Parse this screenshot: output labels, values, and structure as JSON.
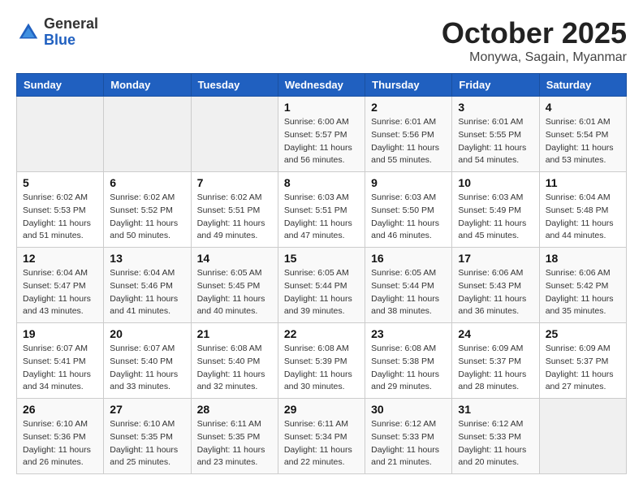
{
  "header": {
    "logo_line1": "General",
    "logo_line2": "Blue",
    "month": "October 2025",
    "location": "Monywa, Sagain, Myanmar"
  },
  "weekdays": [
    "Sunday",
    "Monday",
    "Tuesday",
    "Wednesday",
    "Thursday",
    "Friday",
    "Saturday"
  ],
  "weeks": [
    [
      {
        "day": "",
        "sunrise": "",
        "sunset": "",
        "daylight": ""
      },
      {
        "day": "",
        "sunrise": "",
        "sunset": "",
        "daylight": ""
      },
      {
        "day": "",
        "sunrise": "",
        "sunset": "",
        "daylight": ""
      },
      {
        "day": "1",
        "sunrise": "Sunrise: 6:00 AM",
        "sunset": "Sunset: 5:57 PM",
        "daylight": "Daylight: 11 hours and 56 minutes."
      },
      {
        "day": "2",
        "sunrise": "Sunrise: 6:01 AM",
        "sunset": "Sunset: 5:56 PM",
        "daylight": "Daylight: 11 hours and 55 minutes."
      },
      {
        "day": "3",
        "sunrise": "Sunrise: 6:01 AM",
        "sunset": "Sunset: 5:55 PM",
        "daylight": "Daylight: 11 hours and 54 minutes."
      },
      {
        "day": "4",
        "sunrise": "Sunrise: 6:01 AM",
        "sunset": "Sunset: 5:54 PM",
        "daylight": "Daylight: 11 hours and 53 minutes."
      }
    ],
    [
      {
        "day": "5",
        "sunrise": "Sunrise: 6:02 AM",
        "sunset": "Sunset: 5:53 PM",
        "daylight": "Daylight: 11 hours and 51 minutes."
      },
      {
        "day": "6",
        "sunrise": "Sunrise: 6:02 AM",
        "sunset": "Sunset: 5:52 PM",
        "daylight": "Daylight: 11 hours and 50 minutes."
      },
      {
        "day": "7",
        "sunrise": "Sunrise: 6:02 AM",
        "sunset": "Sunset: 5:51 PM",
        "daylight": "Daylight: 11 hours and 49 minutes."
      },
      {
        "day": "8",
        "sunrise": "Sunrise: 6:03 AM",
        "sunset": "Sunset: 5:51 PM",
        "daylight": "Daylight: 11 hours and 47 minutes."
      },
      {
        "day": "9",
        "sunrise": "Sunrise: 6:03 AM",
        "sunset": "Sunset: 5:50 PM",
        "daylight": "Daylight: 11 hours and 46 minutes."
      },
      {
        "day": "10",
        "sunrise": "Sunrise: 6:03 AM",
        "sunset": "Sunset: 5:49 PM",
        "daylight": "Daylight: 11 hours and 45 minutes."
      },
      {
        "day": "11",
        "sunrise": "Sunrise: 6:04 AM",
        "sunset": "Sunset: 5:48 PM",
        "daylight": "Daylight: 11 hours and 44 minutes."
      }
    ],
    [
      {
        "day": "12",
        "sunrise": "Sunrise: 6:04 AM",
        "sunset": "Sunset: 5:47 PM",
        "daylight": "Daylight: 11 hours and 43 minutes."
      },
      {
        "day": "13",
        "sunrise": "Sunrise: 6:04 AM",
        "sunset": "Sunset: 5:46 PM",
        "daylight": "Daylight: 11 hours and 41 minutes."
      },
      {
        "day": "14",
        "sunrise": "Sunrise: 6:05 AM",
        "sunset": "Sunset: 5:45 PM",
        "daylight": "Daylight: 11 hours and 40 minutes."
      },
      {
        "day": "15",
        "sunrise": "Sunrise: 6:05 AM",
        "sunset": "Sunset: 5:44 PM",
        "daylight": "Daylight: 11 hours and 39 minutes."
      },
      {
        "day": "16",
        "sunrise": "Sunrise: 6:05 AM",
        "sunset": "Sunset: 5:44 PM",
        "daylight": "Daylight: 11 hours and 38 minutes."
      },
      {
        "day": "17",
        "sunrise": "Sunrise: 6:06 AM",
        "sunset": "Sunset: 5:43 PM",
        "daylight": "Daylight: 11 hours and 36 minutes."
      },
      {
        "day": "18",
        "sunrise": "Sunrise: 6:06 AM",
        "sunset": "Sunset: 5:42 PM",
        "daylight": "Daylight: 11 hours and 35 minutes."
      }
    ],
    [
      {
        "day": "19",
        "sunrise": "Sunrise: 6:07 AM",
        "sunset": "Sunset: 5:41 PM",
        "daylight": "Daylight: 11 hours and 34 minutes."
      },
      {
        "day": "20",
        "sunrise": "Sunrise: 6:07 AM",
        "sunset": "Sunset: 5:40 PM",
        "daylight": "Daylight: 11 hours and 33 minutes."
      },
      {
        "day": "21",
        "sunrise": "Sunrise: 6:08 AM",
        "sunset": "Sunset: 5:40 PM",
        "daylight": "Daylight: 11 hours and 32 minutes."
      },
      {
        "day": "22",
        "sunrise": "Sunrise: 6:08 AM",
        "sunset": "Sunset: 5:39 PM",
        "daylight": "Daylight: 11 hours and 30 minutes."
      },
      {
        "day": "23",
        "sunrise": "Sunrise: 6:08 AM",
        "sunset": "Sunset: 5:38 PM",
        "daylight": "Daylight: 11 hours and 29 minutes."
      },
      {
        "day": "24",
        "sunrise": "Sunrise: 6:09 AM",
        "sunset": "Sunset: 5:37 PM",
        "daylight": "Daylight: 11 hours and 28 minutes."
      },
      {
        "day": "25",
        "sunrise": "Sunrise: 6:09 AM",
        "sunset": "Sunset: 5:37 PM",
        "daylight": "Daylight: 11 hours and 27 minutes."
      }
    ],
    [
      {
        "day": "26",
        "sunrise": "Sunrise: 6:10 AM",
        "sunset": "Sunset: 5:36 PM",
        "daylight": "Daylight: 11 hours and 26 minutes."
      },
      {
        "day": "27",
        "sunrise": "Sunrise: 6:10 AM",
        "sunset": "Sunset: 5:35 PM",
        "daylight": "Daylight: 11 hours and 25 minutes."
      },
      {
        "day": "28",
        "sunrise": "Sunrise: 6:11 AM",
        "sunset": "Sunset: 5:35 PM",
        "daylight": "Daylight: 11 hours and 23 minutes."
      },
      {
        "day": "29",
        "sunrise": "Sunrise: 6:11 AM",
        "sunset": "Sunset: 5:34 PM",
        "daylight": "Daylight: 11 hours and 22 minutes."
      },
      {
        "day": "30",
        "sunrise": "Sunrise: 6:12 AM",
        "sunset": "Sunset: 5:33 PM",
        "daylight": "Daylight: 11 hours and 21 minutes."
      },
      {
        "day": "31",
        "sunrise": "Sunrise: 6:12 AM",
        "sunset": "Sunset: 5:33 PM",
        "daylight": "Daylight: 11 hours and 20 minutes."
      },
      {
        "day": "",
        "sunrise": "",
        "sunset": "",
        "daylight": ""
      }
    ]
  ]
}
